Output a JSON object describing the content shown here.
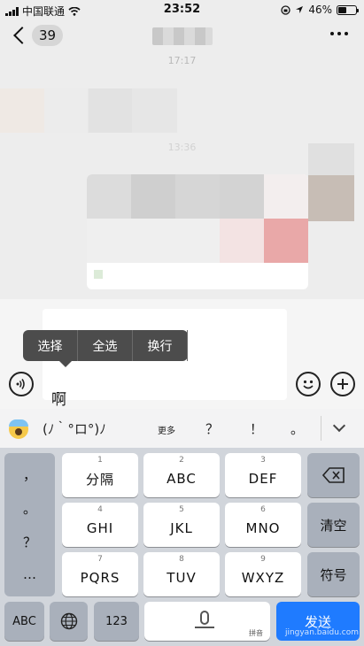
{
  "status_bar": {
    "carrier": "中国联通",
    "time": "23:52",
    "battery": "46%",
    "battery_level": 0.46
  },
  "nav": {
    "back_count": "39"
  },
  "chat": {
    "timestamp_1": "17:17",
    "timestamp_2": "13:36"
  },
  "input": {
    "text": "啊"
  },
  "popup": {
    "items": [
      "选择",
      "全选",
      "换行"
    ]
  },
  "candidates": {
    "items": [
      "(ﾉ｀°ロ°)ﾉ",
      "更多",
      "？",
      "！",
      "。"
    ]
  },
  "keyboard": {
    "punct": [
      "，",
      "。",
      "？",
      "…"
    ],
    "row1": [
      {
        "num": "1",
        "label": "分隔"
      },
      {
        "num": "2",
        "label": "ABC"
      },
      {
        "num": "3",
        "label": "DEF"
      }
    ],
    "row2": [
      {
        "num": "4",
        "label": "GHI"
      },
      {
        "num": "5",
        "label": "JKL"
      },
      {
        "num": "6",
        "label": "MNO"
      }
    ],
    "row3": [
      {
        "num": "7",
        "label": "PQRS"
      },
      {
        "num": "8",
        "label": "TUV"
      },
      {
        "num": "9",
        "label": "WXYZ"
      }
    ],
    "clear": "清空",
    "symbol": "符号",
    "abc": "ABC",
    "num": "123",
    "space_note": "拼音",
    "send": "发送"
  },
  "watermark": "jingyan.baidu.com"
}
